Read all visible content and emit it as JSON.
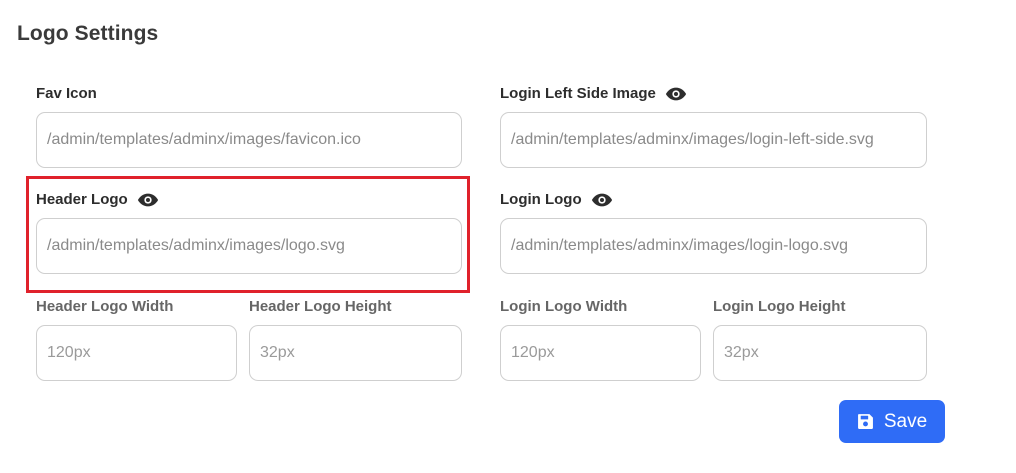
{
  "section": {
    "title": "Logo Settings"
  },
  "fields": {
    "fav_icon": {
      "label": "Fav Icon",
      "value": "/admin/templates/adminx/images/favicon.ico"
    },
    "login_left_image": {
      "label": "Login Left Side Image",
      "value": "/admin/templates/adminx/images/login-left-side.svg"
    },
    "header_logo": {
      "label": "Header Logo",
      "value": "/admin/templates/adminx/images/logo.svg"
    },
    "login_logo": {
      "label": "Login Logo",
      "value": "/admin/templates/adminx/images/login-logo.svg"
    },
    "header_logo_width": {
      "label": "Header Logo Width",
      "placeholder": "120px"
    },
    "header_logo_height": {
      "label": "Header Logo Height",
      "placeholder": "32px"
    },
    "login_logo_width": {
      "label": "Login Logo Width",
      "placeholder": "120px"
    },
    "login_logo_height": {
      "label": "Login Logo Height",
      "placeholder": "32px"
    }
  },
  "actions": {
    "save_label": "Save",
    "save_icon": "floppy-disk-icon"
  },
  "icons": {
    "preview": "eye-icon"
  },
  "colors": {
    "accent": "#2f6cf6",
    "highlight": "#e0212b"
  }
}
